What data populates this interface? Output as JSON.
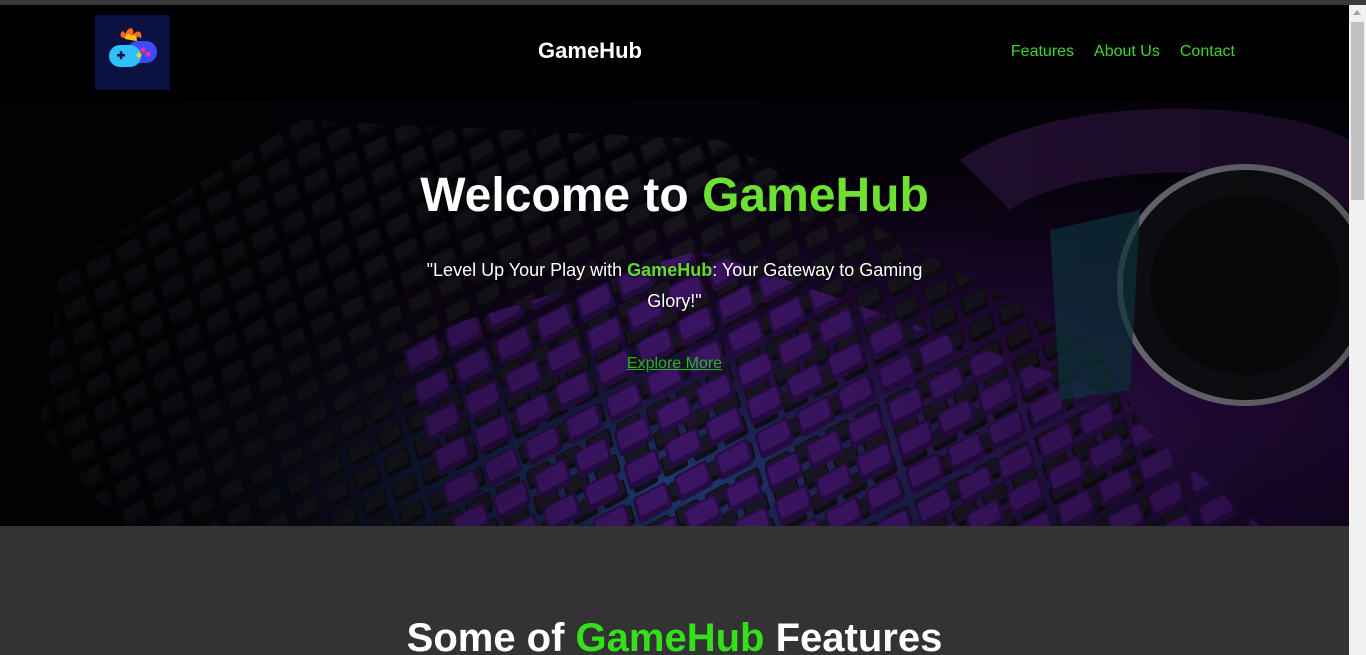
{
  "header": {
    "logo_alt": "GameHub logo",
    "title": "GameHub",
    "nav": [
      {
        "label": "Features"
      },
      {
        "label": "About Us"
      },
      {
        "label": "Contact"
      }
    ]
  },
  "hero": {
    "title_prefix": "Welcome to ",
    "title_accent": "GameHub",
    "tagline_prefix": "\"Level Up Your Play with ",
    "tagline_accent": "GameHub",
    "tagline_suffix": ": Your Gateway to Gaming Glory!\"",
    "cta_label": "Explore More"
  },
  "features": {
    "title_prefix": "Some of ",
    "title_accent": "GameHub",
    "title_suffix": " Features"
  },
  "colors": {
    "accent": "#3fd62a",
    "header_bg": "#000000",
    "page_bg": "#333333"
  }
}
